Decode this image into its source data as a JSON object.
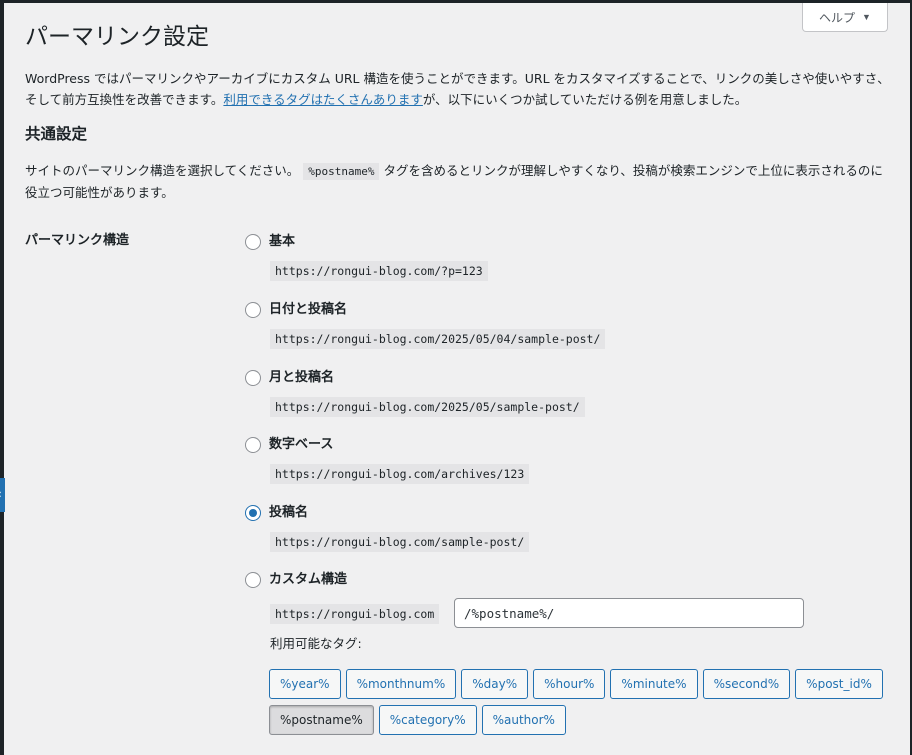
{
  "header": {
    "help_label": "ヘルプ",
    "help_caret": "▼",
    "title": "パーマリンク設定"
  },
  "intro": {
    "text_before": "WordPress ではパーマリンクやアーカイブにカスタム URL 構造を使うことができます。URL をカスタマイズすることで、リンクの美しさや使いやすさ、そして前方互換性を改善できます。",
    "link": "利用できるタグはたくさんあります",
    "text_after": "が、以下にいくつか試していただける例を用意しました。"
  },
  "common": {
    "heading": "共通設定",
    "desc_before": "サイトのパーマリンク構造を選択してください。",
    "desc_code": "%postname%",
    "desc_after": " タグを含めるとリンクが理解しやすくなり、投稿が検索エンジンで上位に表示されるのに役立つ可能性があります。"
  },
  "structure": {
    "label": "パーマリンク構造",
    "options": [
      {
        "label": "基本",
        "url": "https://rongui-blog.com/?p=123",
        "checked": false
      },
      {
        "label": "日付と投稿名",
        "url": "https://rongui-blog.com/2025/05/04/sample-post/",
        "checked": false
      },
      {
        "label": "月と投稿名",
        "url": "https://rongui-blog.com/2025/05/sample-post/",
        "checked": false
      },
      {
        "label": "数字ベース",
        "url": "https://rongui-blog.com/archives/123",
        "checked": false
      },
      {
        "label": "投稿名",
        "url": "https://rongui-blog.com/sample-post/",
        "checked": true
      }
    ],
    "custom": {
      "label": "カスタム構造",
      "checked": false,
      "base": "https://rongui-blog.com",
      "value": "/%postname%/"
    },
    "tags_label": "利用可能なタグ:",
    "tags": [
      "%year%",
      "%monthnum%",
      "%day%",
      "%hour%",
      "%minute%",
      "%second%",
      "%post_id%",
      "%postname%",
      "%category%",
      "%author%"
    ],
    "active_tag": "%postname%"
  },
  "colors": {
    "accent": "#2271b1",
    "background": "#f0f0f1",
    "text": "#1d2327"
  }
}
